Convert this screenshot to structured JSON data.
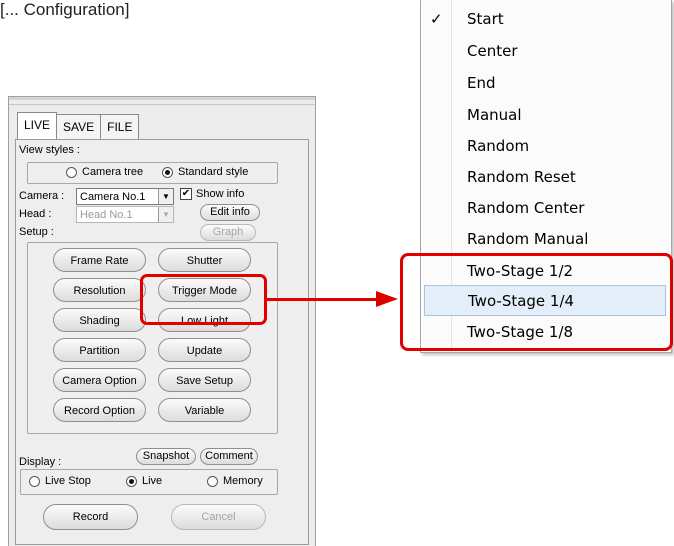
{
  "caption": "[... Configuration]",
  "tabs": [
    "LIVE",
    "SAVE",
    "FILE"
  ],
  "view_styles": {
    "label": "View styles :",
    "options": [
      "Camera tree",
      "Standard style"
    ],
    "selected": "Standard style"
  },
  "camera": {
    "label": "Camera :",
    "value": "Camera No.1",
    "show_info_label": "Show info",
    "show_info_checked": true,
    "edit_info_label": "Edit info"
  },
  "head": {
    "label": "Head :",
    "value": "Head No.1",
    "graph_label": "Graph"
  },
  "setup": {
    "label": "Setup :",
    "buttons": [
      "Frame Rate",
      "Shutter",
      "Resolution",
      "Trigger Mode",
      "Shading",
      "Low Light",
      "Partition",
      "Update",
      "Camera Option",
      "Save Setup",
      "Record Option",
      "Variable"
    ]
  },
  "display": {
    "label": "Display :",
    "snapshot_label": "Snapshot",
    "comment_label": "Comment",
    "options": [
      "Live Stop",
      "Live",
      "Memory"
    ],
    "selected": "Live"
  },
  "actions": {
    "record_label": "Record",
    "cancel_label": "Cancel"
  },
  "trigger_menu": {
    "items": [
      "Start",
      "Center",
      "End",
      "Manual",
      "Random",
      "Random Reset",
      "Random Center",
      "Random Manual",
      "Two-Stage 1/2",
      "Two-Stage 1/4",
      "Two-Stage 1/8"
    ],
    "checked": "Start",
    "hovered": "Two-Stage 1/4",
    "check_glyph": "✓"
  },
  "colors": {
    "callout_red": "#e00000",
    "menu_hover": "#e4eef8"
  }
}
